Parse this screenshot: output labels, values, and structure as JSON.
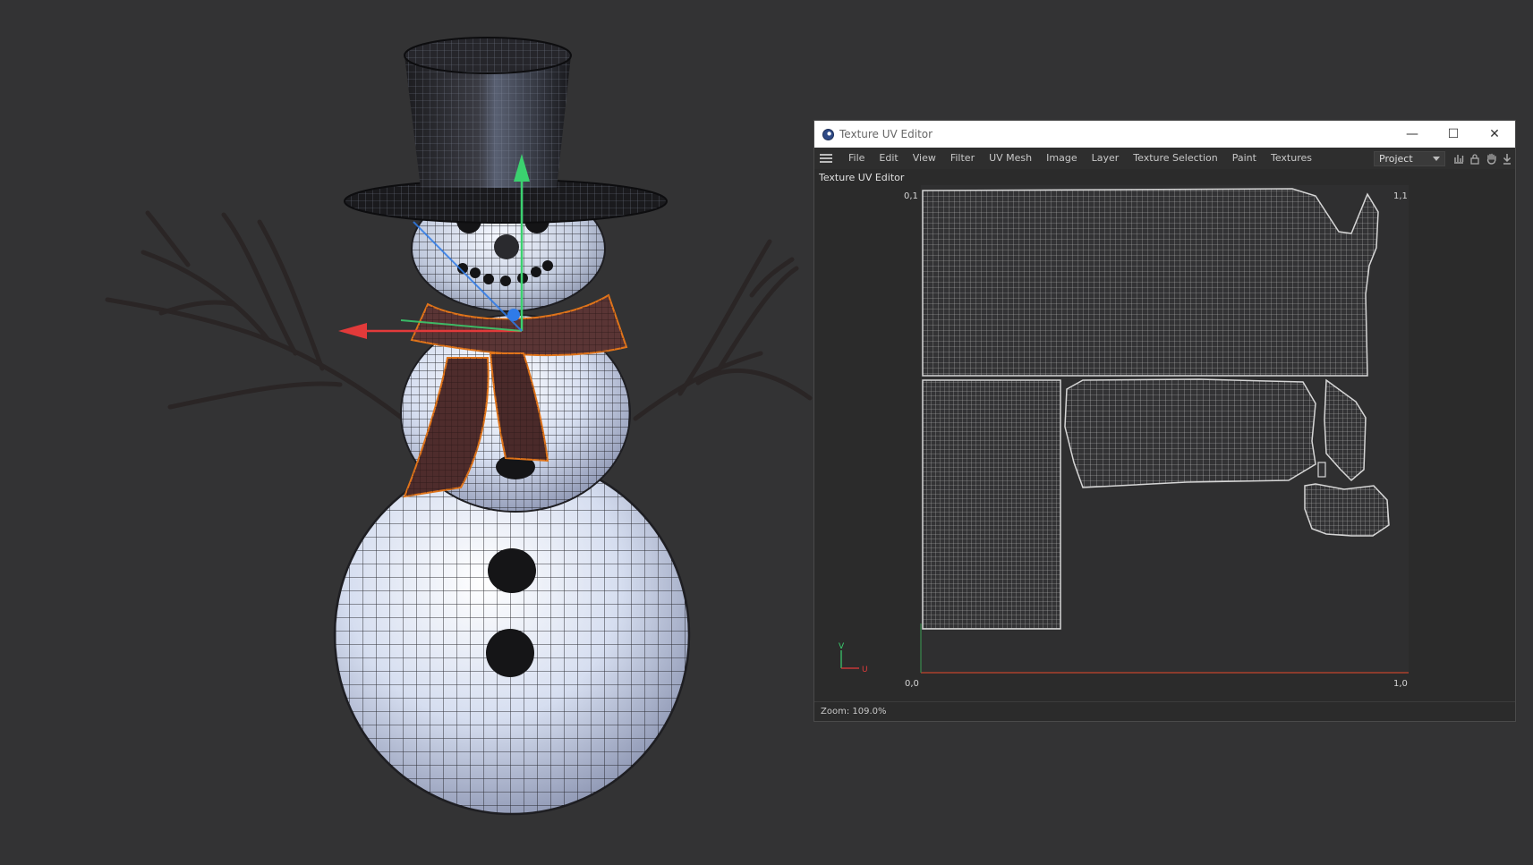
{
  "window": {
    "title": "Texture UV Editor",
    "minimize_glyph": "—",
    "maximize_glyph": "☐",
    "close_glyph": "✕"
  },
  "menu": {
    "items": [
      "File",
      "Edit",
      "View",
      "Filter",
      "UV Mesh",
      "Image",
      "Layer",
      "Texture Selection",
      "Paint",
      "Textures"
    ],
    "project_select": "Project"
  },
  "panel": {
    "label": "Texture UV Editor"
  },
  "uv_view": {
    "corner_top_left": "0,1",
    "corner_top_right": "1,1",
    "corner_bottom_left": "0,0",
    "corner_bottom_right": "1,0",
    "axis_v": "V",
    "axis_u": "U"
  },
  "status": {
    "zoom": "Zoom: 109.0%"
  },
  "colors": {
    "viewport_bg": "#333334",
    "axis_x": "#e23a3a",
    "axis_y": "#3bd16f",
    "axis_z": "#2f7be8",
    "selection": "#e0741a",
    "uv_wire": "#bdbdbd"
  },
  "icons": {
    "app": "cinema4d-logo-icon",
    "menu": "hamburger-icon",
    "histogram": "histogram-icon",
    "lock": "lock-icon",
    "hand": "hand-icon",
    "pin": "pin-icon"
  }
}
